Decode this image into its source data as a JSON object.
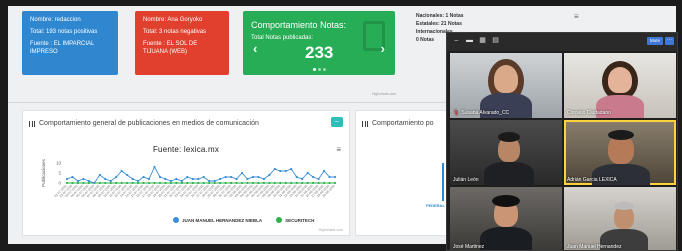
{
  "cards": {
    "blue": {
      "name": "Nombre: redaccion",
      "total": "Total: 193 notas positivas",
      "source": "Fuente : EL IMPARCIAL IMPRESO"
    },
    "red": {
      "name": "Nombre: Ana Goryoko",
      "total": "Total: 3 notas negativas",
      "source": "Fuente : EL SOL DE TIJUANA (WEB)"
    },
    "green": {
      "title": "Comportamiento Notas:",
      "subtitle": "Total Notas publicadas:",
      "value": "233",
      "prev_icon": "chevron-left-icon",
      "next_icon": "chevron-right-icon"
    }
  },
  "highcharts_credit": "Highcharts.com",
  "right_list": {
    "line1": "Nacionales: 1 Notas",
    "line2": "Estatales: 21 Notas",
    "line3": "Internacionales",
    "line4": "0 Notas"
  },
  "panel_left": {
    "title": "Comportamiento general de publicaciones en medios de comunicación",
    "button_label": "–",
    "chart_title": "Fuente: lexica.mx",
    "credit": "Highcharts.com"
  },
  "panel_right": {
    "title": "Comportamiento po",
    "fragment": "FEDERAL"
  },
  "chart_data": {
    "type": "line",
    "title": "Fuente: lexica.mx",
    "ylabel": "Publicaciones",
    "ylim": [
      0,
      10
    ],
    "yticks": [
      "10",
      "5",
      "0"
    ],
    "x": [
      "01-07-2020",
      "02-07-2020",
      "03-07-2020",
      "04-07-2020",
      "05-07-2020",
      "06-07-2020",
      "07-07-2020",
      "08-07-2020",
      "09-07-2020",
      "10-07-2020",
      "11-07-2020",
      "12-07-2020",
      "13-07-2020",
      "14-07-2020",
      "15-07-2020",
      "16-07-2020",
      "17-07-2020",
      "18-07-2020",
      "19-07-2020",
      "20-07-2020",
      "21-07-2020",
      "22-07-2020",
      "23-07-2020",
      "24-07-2020",
      "25-07-2020",
      "26-07-2020",
      "27-07-2020",
      "28-07-2020",
      "29-07-2020",
      "30-07-2020",
      "31-07-2020",
      "01-08-2020",
      "02-08-2020",
      "03-08-2020",
      "04-08-2020",
      "05-08-2020",
      "06-08-2020",
      "07-08-2020",
      "08-08-2020",
      "09-08-2020",
      "10-08-2020",
      "11-08-2020",
      "12-08-2020",
      "13-08-2020",
      "14-08-2020",
      "15-08-2020",
      "16-08-2020",
      "17-08-2020",
      "18-08-2020",
      "19-08-2020"
    ],
    "series": [
      {
        "name": "JUAN MANUEL HERNANDEZ NIEBLA",
        "color": "#3a8fd6",
        "values": [
          2,
          3,
          1,
          2,
          1,
          0,
          4,
          2,
          1,
          3,
          6,
          4,
          2,
          1,
          3,
          2,
          8,
          3,
          2,
          1,
          2,
          1,
          3,
          2,
          2,
          3,
          1,
          1,
          2,
          3,
          3,
          2,
          5,
          2,
          3,
          3,
          2,
          4,
          7,
          6,
          6,
          7,
          3,
          2,
          5,
          3,
          2,
          6,
          3,
          3
        ]
      },
      {
        "name": "SECURITECH",
        "color": "#2db24e",
        "values": [
          0,
          0,
          0,
          0,
          0,
          0,
          0,
          0,
          0,
          0,
          0,
          0,
          0,
          0,
          0,
          0,
          0,
          0,
          0,
          0,
          0,
          0,
          0,
          0,
          0,
          0,
          0,
          0,
          0,
          0,
          0,
          0,
          0,
          0,
          0,
          0,
          0,
          0,
          0,
          0,
          0,
          0,
          0,
          0,
          0,
          0,
          0,
          0,
          0,
          0
        ]
      }
    ],
    "grid": false,
    "legend_position": "bottom"
  },
  "meeting": {
    "mute_label": "Mute",
    "more_label": "···",
    "participants": [
      {
        "name": "Susana Alvarado_CC",
        "muted": true,
        "active": false
      },
      {
        "name": "Consejo Ciudadano",
        "muted": false,
        "active": false
      },
      {
        "name": "Julián León",
        "muted": false,
        "active": false
      },
      {
        "name": "Adrián Garcia LEXICA",
        "muted": false,
        "active": true
      },
      {
        "name": "José Martinez",
        "muted": false,
        "active": false
      },
      {
        "name": "Juan Manuel Hernandez",
        "muted": false,
        "active": false
      }
    ]
  }
}
